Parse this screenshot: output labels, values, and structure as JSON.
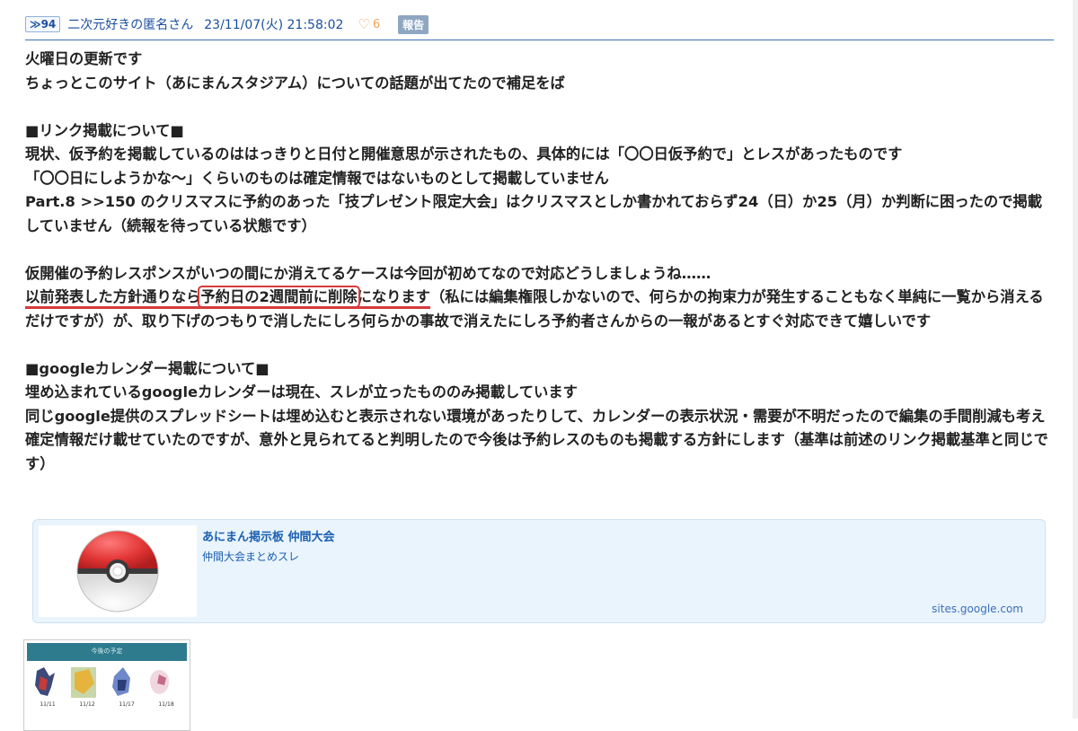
{
  "post": {
    "res_number": "≫94",
    "author": "二次元好きの匿名さん",
    "datetime": "23/11/07(火) 21:58:02",
    "like_count": "6",
    "report_label": "報告"
  },
  "body": {
    "p1_line1": "火曜日の更新です",
    "p1_line2": "ちょっとこのサイト（あにまんスタジアム）についての話題が出てたので補足をば",
    "p2_heading": "■リンク掲載について■",
    "p2_line1": "現状、仮予約を掲載しているのははっきりと日付と開催意思が示されたもの、具体的には「〇〇日仮予約で」とレスがあったものです",
    "p2_line2": "「〇〇日にしようかな～」くらいのものは確定情報ではないものとして掲載していません",
    "p2_line3": "Part.8 >>150 のクリスマスに予約のあった「技プレゼント限定大会」はクリスマスとしか書かれておらず24（日）か25（月）か判断に困ったので掲載していません（続報を待っている状態です）",
    "p3_line1": "仮開催の予約レスポンスがいつの間にか消えてるケースは今回が初めてなので対応どうしましょうね……",
    "p3_u1": "以前発表した方針通りなら",
    "p3_box": "予約日の2週間前に削除",
    "p3_u2": "になります",
    "p3_rest": "（私には編集権限しかないので、何らかの拘束力が発生することもなく単純に一覧から消えるだけですが）が、取り下げのつもりで消したにしろ何らかの事故で消えたにしろ予約者さんからの一報があるとすぐ対応できて嬉しいです",
    "p4_heading": "■googleカレンダー掲載について■",
    "p4_line1": "埋め込まれているgoogleカレンダーは現在、スレが立ったもののみ掲載しています",
    "p4_line2": "同じgoogle提供のスプレッドシートは埋め込むと表示されない環境があったりして、カレンダーの表示状況・需要が不明だったので編集の手間削減も考え確定情報だけ載せていたのですが、意外と見られてると判明したので今後は予約レスのものも掲載する方針にします（基準は前述のリンク掲載基準と同じです）"
  },
  "link_card": {
    "title": "あにまん掲示板 仲間大会",
    "description": "仲間大会まとめスレ",
    "domain": "sites.google.com",
    "thumbnail_icon": "pokeball-icon"
  },
  "image": {
    "banner": "今後の予定",
    "dates": [
      "11/11",
      "11/12",
      "11/17",
      "11/18"
    ]
  },
  "colors": {
    "link_blue": "#1a4fa0",
    "highlight_red": "#d63a3a",
    "card_bg": "#eaf4fc",
    "like_orange": "#f0a257"
  }
}
